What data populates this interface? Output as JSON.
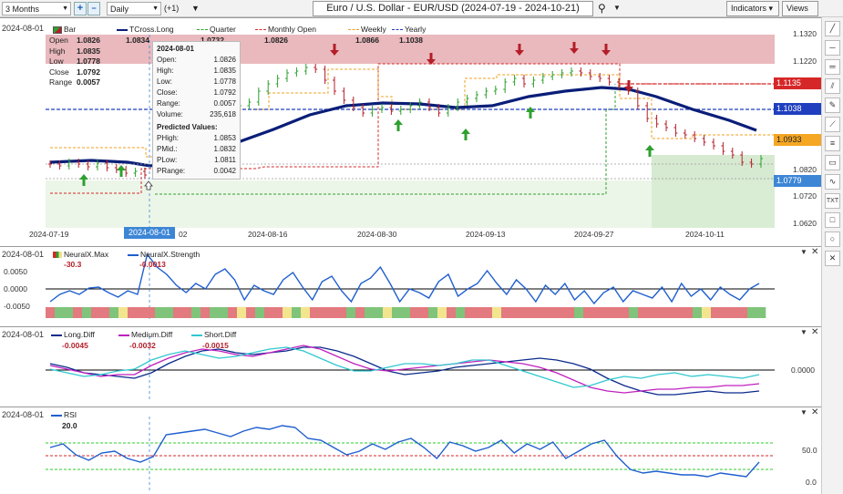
{
  "toolbar": {
    "period": "3 Months",
    "interval": "Daily",
    "offset": "(+1)",
    "symbol": "Euro / U.S. Dollar - EUR/USD (2024-07-19 - 2024-10-21)",
    "indicators": "Indicators",
    "views": "Views"
  },
  "legend": {
    "date": "2024-08-01",
    "items": [
      {
        "label": "Bar"
      },
      {
        "label": "TCross.Long"
      },
      {
        "label": "Quarter"
      },
      {
        "label": "Monthly Open"
      },
      {
        "label": "Weekly"
      },
      {
        "label": "Yearly"
      }
    ]
  },
  "ohlc": {
    "open_label": "Open",
    "open": "1.0826",
    "open2": "1.0834",
    "open3": "1.0732",
    "open4": "1.0826",
    "open5": "1.0866",
    "open6": "1.1038",
    "high_label": "High",
    "high": "1.0835",
    "low_label": "Low",
    "low": "1.0778",
    "close_label": "Close",
    "close": "1.0792",
    "range_label": "Range",
    "range": "0.0057"
  },
  "tooltip": {
    "date": "2024-08-01",
    "open_l": "Open:",
    "open": "1.0826",
    "high_l": "High:",
    "high": "1.0835",
    "low_l": "Low:",
    "low": "1.0778",
    "close_l": "Close:",
    "close": "1.0792",
    "range_l": "Range:",
    "range": "0.0057",
    "vol_l": "Volume:",
    "vol": "235,618",
    "pred": "Predicted Values:",
    "phigh_l": "PHigh:",
    "phigh": "1.0853",
    "pmid_l": "PMid.:",
    "pmid": "1.0832",
    "plow_l": "PLow:",
    "plow": "1.0811",
    "prange_l": "PRange:",
    "prange": "0.0042"
  },
  "price_axis": {
    "t1": "1.1320",
    "t2": "1.1220",
    "t3": "1.0820",
    "t4": "1.0720",
    "t5": "1.0620"
  },
  "price_labels": {
    "monthly": "1.1135",
    "yearly": "1.1038",
    "weekly": "1.0933",
    "close": "1.0779"
  },
  "x_axis": {
    "d1": "2024-07-19",
    "d2": "2024-08-01",
    "d2s": "02",
    "d3": "2024-08-16",
    "d4": "2024-08-30",
    "d5": "2024-09-13",
    "d6": "2024-09-27",
    "d7": "2024-10-11"
  },
  "pane2": {
    "date": "2024-08-01",
    "l1": "NeuralX.Max",
    "l2": "NeuralX.Strength",
    "v1": "-30.3",
    "v2": "-0.0013",
    "t1": "0.0050",
    "t2": "0.0000",
    "t3": "-0.0050"
  },
  "pane3": {
    "date": "2024-08-01",
    "l1": "Long.Diff",
    "l2": "Medium.Diff",
    "l3": "Short.Diff",
    "v1": "-0.0045",
    "v2": "-0.0032",
    "v3": "-0.0015",
    "t1": "0.0000"
  },
  "pane4": {
    "date": "2024-08-01",
    "l1": "RSI",
    "v1": "20.0",
    "t1": "50.0",
    "t2": "0.0"
  },
  "colors": {
    "up": "#2ea02e",
    "down": "#b41e28",
    "tcross": "#0a1e78",
    "monthly": "#d62728",
    "weekly": "#f0a020",
    "yearly": "#1f3fbf",
    "quarter": "#2ea02e",
    "rsi": "#1f5fcf"
  }
}
